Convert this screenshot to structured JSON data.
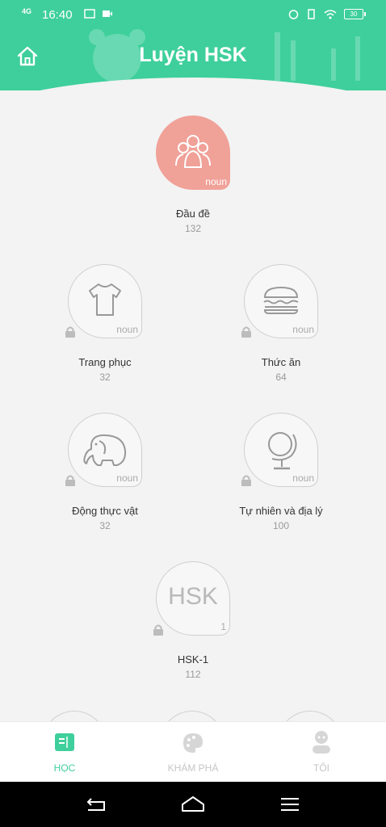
{
  "status_bar": {
    "network": "4G",
    "time": "16:40",
    "battery": "30"
  },
  "header": {
    "title": "Luyện HSK"
  },
  "categories": [
    {
      "name": "Đầu đề",
      "count": "132",
      "tag": "noun"
    },
    {
      "name": "Trang phục",
      "count": "32",
      "tag": "noun"
    },
    {
      "name": "Thức ăn",
      "count": "64",
      "tag": "noun"
    },
    {
      "name": "Động thực vật",
      "count": "32",
      "tag": "noun"
    },
    {
      "name": "Tự nhiên và địa lý",
      "count": "100",
      "tag": "noun"
    },
    {
      "name": "HSK-1",
      "count": "112",
      "tag": "1",
      "badge_text": "HSK"
    }
  ],
  "nav": {
    "learn": "HỌC",
    "explore": "KHÁM PHÁ",
    "me": "TÔI"
  },
  "colors": {
    "accent": "#3ecf9c",
    "active_category": "#f0a198"
  }
}
